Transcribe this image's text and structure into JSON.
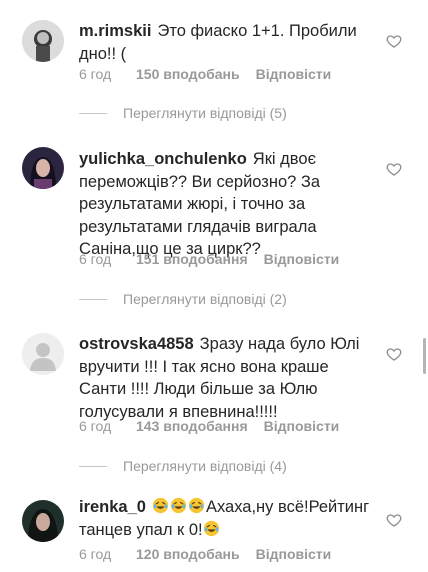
{
  "comments": [
    {
      "username": "m.rimskii",
      "text": "Это фиаско 1+1. Пробили дно!! (",
      "time": "6 год",
      "likes": "150 вподобань",
      "reply_label": "Відповісти",
      "view_replies": "Переглянути відповіді (5)"
    },
    {
      "username": "yulichka_onchulenko",
      "text": "Які двоє переможців?? Ви серйозно? За результатами жюрі, і точно за результатами глядачів виграла Саніна,що це за цирк??",
      "time": "6 год",
      "likes": "151 вподобання",
      "reply_label": "Відповісти",
      "view_replies": "Переглянути відповіді (2)"
    },
    {
      "username": "ostrovska4858",
      "text": "Зразу нада було Юлі вручити !!! І так ясно вона краше Санти !!!! Люди більше за Юлю голусували я впевнина!!!!!",
      "time": "6 год",
      "likes": "143 вподобання",
      "reply_label": "Відповісти",
      "view_replies": "Переглянути відповіді (4)"
    },
    {
      "username": "irenka_0",
      "text_before": "",
      "text_after_emoji": "Ахаха,ну всё!Рейтинг танцев упал к 0!",
      "time": "6 год",
      "likes": "120 вподобань",
      "reply_label": "Відповісти"
    }
  ],
  "icons": {
    "heart": "heart-outline-icon",
    "emoji": "laughing-tears-emoji-icon"
  },
  "colors": {
    "text": "#262626",
    "secondary": "#999999",
    "emoji": "#f7c531"
  }
}
